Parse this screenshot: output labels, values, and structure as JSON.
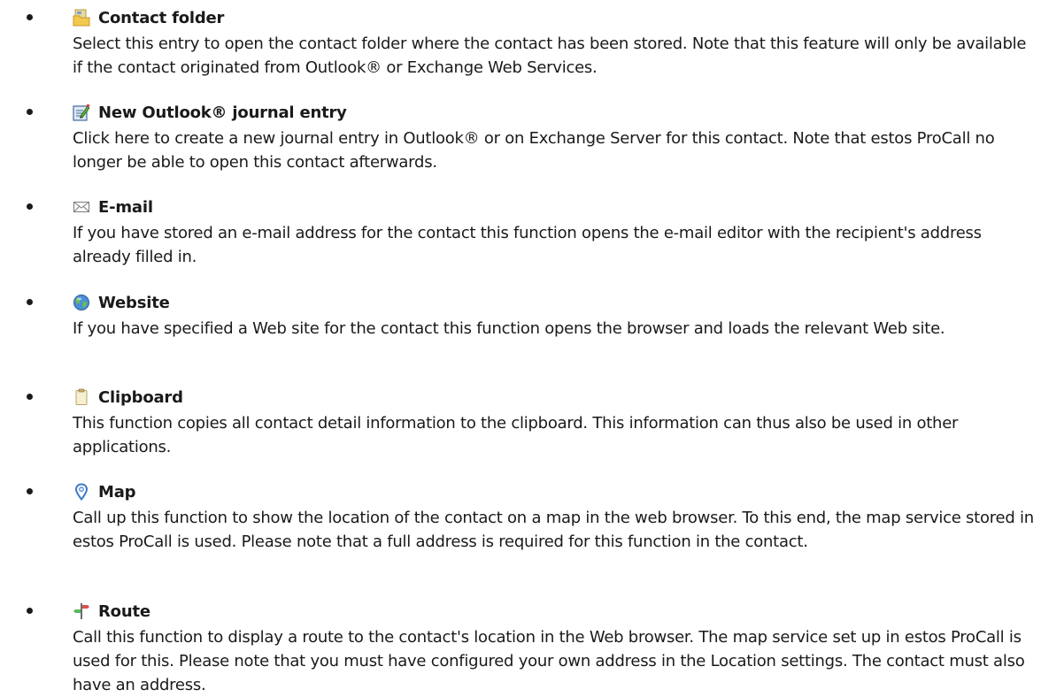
{
  "items": [
    {
      "icon": "folder-icon",
      "title": "Contact folder",
      "description": "Select this entry to open the contact folder where the contact has been stored. Note that this feature will only be available  if the contact originated from Outlook® or Exchange Web Services."
    },
    {
      "icon": "journal-edit-icon",
      "title": "New Outlook® journal entry",
      "description": "Click here to create a new journal entry in Outlook® or on Exchange Server for this contact. Note that estos ProCall no longer be able to open this contact afterwards."
    },
    {
      "icon": "envelope-icon",
      "title": "E-mail",
      "description": "If you have stored an e-mail address  for the contact this function opens the e-mail editor with the recipient's address  already filled in."
    },
    {
      "icon": "globe-icon",
      "title": "Website",
      "description": "If you have specified  a Web site for the contact this function opens the browser  and loads the relevant Web site."
    },
    {
      "icon": "clipboard-icon",
      "title": "Clipboard",
      "description": "This function copies all contact detail information to the clipboard. This information  can thus also be used in other applications."
    },
    {
      "icon": "map-pin-icon",
      "title": "Map",
      "description": "Call up this function to show the location of the contact on a map in the web browser.  To this end, the map service stored in estos ProCall is used. Please note that a full address  is required for this function in the contact."
    },
    {
      "icon": "signpost-icon",
      "title": "Route",
      "description": "Call this function to display  a route to the contact's location in the Web browser.  The map service set up in estos ProCall is used for this. Please note that you must have configured your own address in the Location settings. The contact must also have an address."
    }
  ]
}
